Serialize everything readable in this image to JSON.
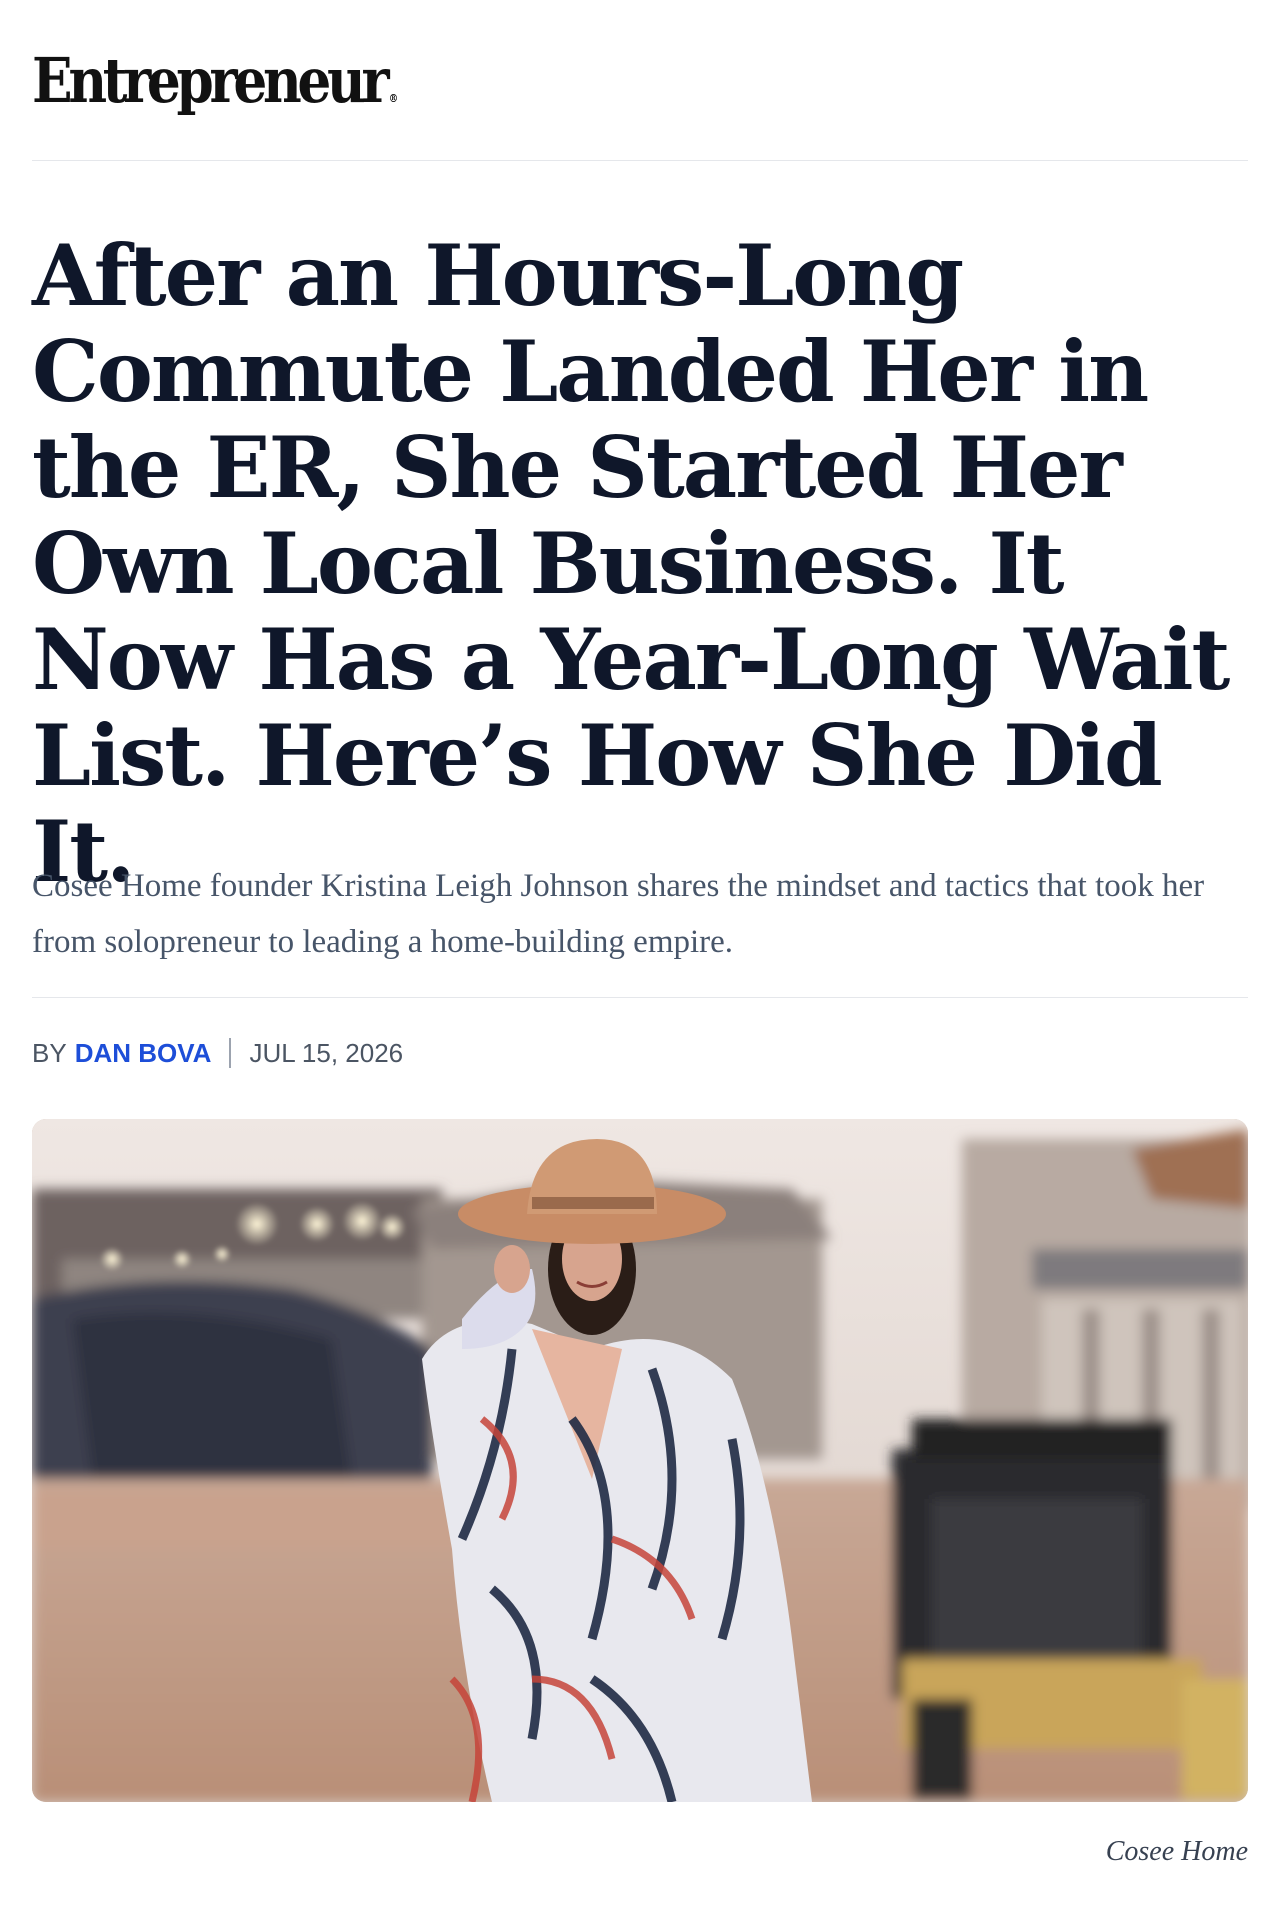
{
  "brand": {
    "logo_text": "Entrepreneur",
    "registered_mark": "®"
  },
  "article": {
    "headline": "After an Hours-Long Commute Landed Her in the ER, She Started Her Own Local Business. It Now Has a Year-Long Wait List. Here’s How She Did It.",
    "dek": "Cosee Home founder Kristina Leigh Johnson shares the mindset and tactics that took her from solopreneur to leading a home-building empire.",
    "byline_prefix": "BY",
    "author": "DAN BOVA",
    "date": "JUL 15, 2026",
    "image_credit": "Cosee Home"
  },
  "colors": {
    "headline": "#0f172a",
    "dek": "#475569",
    "author_link": "#1d4ed8",
    "rule": "#e5e7eb"
  }
}
